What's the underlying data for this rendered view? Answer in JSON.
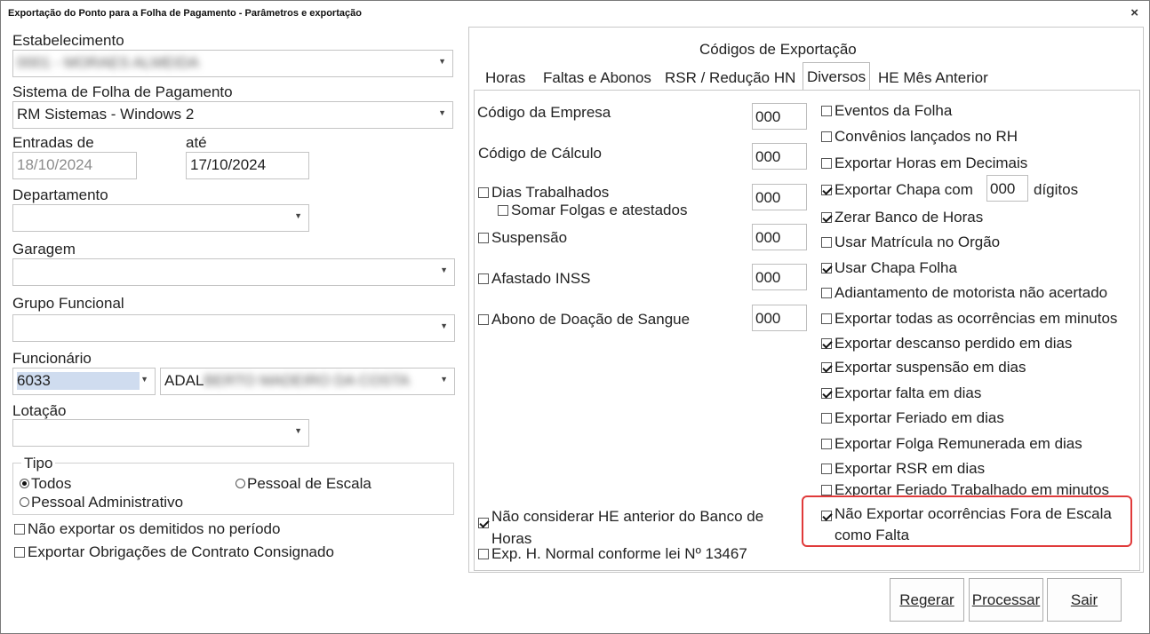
{
  "window": {
    "title": "Exportação do Ponto para a Folha de Pagamento - Parâmetros e exportação",
    "close": "×"
  },
  "left": {
    "estabelecimento_label": "Estabelecimento",
    "estabelecimento_value": "0001 - MORAES ALMEIDA",
    "sistema_label": "Sistema de Folha de Pagamento",
    "sistema_value": "RM Sistemas - Windows 2",
    "entradas_label": "Entradas de",
    "entradas_value": "18/10/2024",
    "ate_label": "até",
    "ate_value": "17/10/2024",
    "departamento_label": "Departamento",
    "departamento_value": "",
    "garagem_label": "Garagem",
    "garagem_value": "",
    "grupo_label": "Grupo Funcional",
    "grupo_value": "",
    "funcionario_label": "Funcionário",
    "funcionario_code": "6033",
    "funcionario_name_visible": "ADAL",
    "funcionario_name_blurred": "BERTO MADEIRO DA COSTA",
    "lotacao_label": "Lotação",
    "lotacao_value": "",
    "tipo_title": "Tipo",
    "tipo_todos": "Todos",
    "tipo_escala": "Pessoal de Escala",
    "tipo_admin": "Pessoal Administrativo",
    "nao_exportar_demitidos": "Não exportar os demitidos no período",
    "exportar_obrigacoes": "Exportar Obrigações de Contrato Consignado"
  },
  "panel": {
    "title": "Códigos de Exportação",
    "tabs": [
      "Horas",
      "Faltas e Abonos",
      "RSR / Redução HN",
      "Diversos",
      "HE Mês Anterior"
    ],
    "codigo_empresa_label": "Código da Empresa",
    "codigo_empresa_value": "000",
    "codigo_calculo_label": "Código de Cálculo",
    "codigo_calculo_value": "000",
    "dias_trabalhados": "Dias Trabalhados",
    "dias_trabalhados_value": "000",
    "somar_folgas": "Somar Folgas e atestados",
    "suspensao": "Suspensão",
    "suspensao_value": "000",
    "afastado_inss": "Afastado INSS",
    "afastado_inss_value": "000",
    "abono_doacao": "Abono de Doação de Sangue",
    "abono_doacao_value": "000",
    "nao_considerar_he_1": "Não considerar HE anterior do Banco de",
    "nao_considerar_he_2": "Horas",
    "exp_h_normal": "Exp. H. Normal conforme lei Nº 13467",
    "right_options": [
      {
        "label": "Eventos da Folha",
        "checked": false
      },
      {
        "label": "Convênios lançados no RH",
        "checked": false
      },
      {
        "label": "Exportar Horas em Decimais",
        "checked": false
      },
      {
        "label": "Exportar Chapa com",
        "checked": true
      },
      {
        "label": "Zerar Banco de Horas",
        "checked": true
      },
      {
        "label": "Usar Matrícula no Orgão",
        "checked": false
      },
      {
        "label": "Usar Chapa Folha",
        "checked": true
      },
      {
        "label": "Adiantamento de motorista não acertado",
        "checked": false
      },
      {
        "label": "Exportar todas as ocorrências em minutos",
        "checked": false
      },
      {
        "label": "Exportar descanso perdido em dias",
        "checked": true
      },
      {
        "label": "Exportar suspensão em dias",
        "checked": true
      },
      {
        "label": "Exportar falta em dias",
        "checked": true
      },
      {
        "label": "Exportar Feriado em dias",
        "checked": false
      },
      {
        "label": "Exportar Folga Remunerada em dias",
        "checked": false
      },
      {
        "label": "Exportar RSR em dias",
        "checked": false
      },
      {
        "label": "Exportar Feriado Trabalhado em minutos",
        "checked": false
      }
    ],
    "chapa_digits_value": "000",
    "chapa_digits_suffix": "dígitos",
    "nao_exportar_fora_1": "Não Exportar ocorrências Fora de Escala",
    "nao_exportar_fora_2": "como Falta"
  },
  "buttons": {
    "regerar": "Regerar",
    "processar": "Processar",
    "sair": "Sair"
  }
}
